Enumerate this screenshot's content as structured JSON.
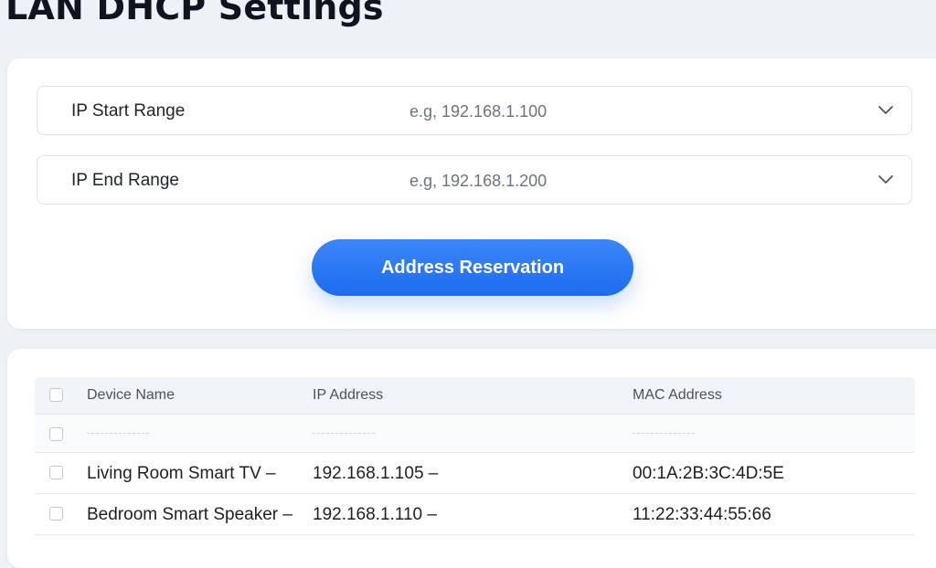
{
  "page": {
    "title": "LAN DHCP Settings"
  },
  "form": {
    "start_range": {
      "label": "IP Start Range",
      "placeholder": "e.g, 192.168.1.100"
    },
    "end_range": {
      "label": "IP End Range",
      "placeholder": "e.g, 192.168.1.200"
    },
    "reserve_button": "Address Reservation"
  },
  "table": {
    "columns": [
      "Device Name",
      "IP Address",
      "MAC Address"
    ],
    "rows": [
      {
        "name": "Living Room Smart TV  –",
        "ip": "192.168.1.105  –",
        "mac": "00:1A:2B:3C:4D:5E"
      },
      {
        "name": "Bedroom Smart Speaker  –",
        "ip": "192.168.1.110  –",
        "mac": "11:22:33:44:55:66"
      }
    ]
  },
  "icons": {
    "dropdown": "chevron-down-icon",
    "checkbox": "checkbox-icon"
  },
  "colors": {
    "accent": "#1d6cf0",
    "background": "#eef1f6",
    "card": "#ffffff"
  }
}
